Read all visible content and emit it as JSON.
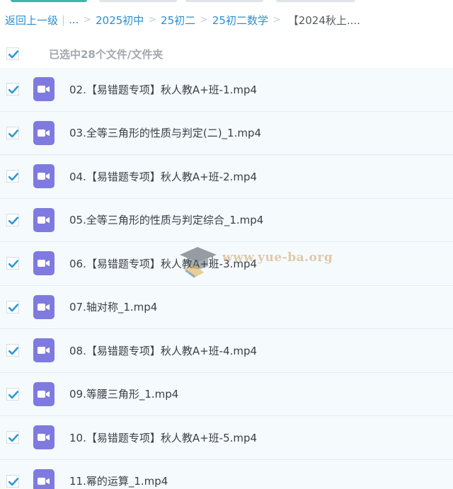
{
  "breadcrumb": {
    "back_label": "返回上一级",
    "separator_bar": "|",
    "ellipsis": "...",
    "chevron": ">",
    "items": [
      "2025初中",
      "25初二",
      "25初二数学"
    ],
    "current": "【2024秋上...."
  },
  "selection": {
    "summary": "已选中28个文件/文件夹",
    "select_all_checked": true
  },
  "files": [
    {
      "name": "02.【易错题专项】秋人教A+班-1.mp4",
      "checked": true,
      "icon": "video-file-icon"
    },
    {
      "name": "03.全等三角形的性质与判定(二)_1.mp4",
      "checked": true,
      "icon": "video-file-icon"
    },
    {
      "name": "04.【易错题专项】秋人教A+班-2.mp4",
      "checked": true,
      "icon": "video-file-icon"
    },
    {
      "name": "05.全等三角形的性质与判定综合_1.mp4",
      "checked": true,
      "icon": "video-file-icon"
    },
    {
      "name": "06.【易错题专项】秋人教A+班-3.mp4",
      "checked": true,
      "icon": "video-file-icon"
    },
    {
      "name": "07.轴对称_1.mp4",
      "checked": true,
      "icon": "video-file-icon"
    },
    {
      "name": "08.【易错题专项】秋人教A+班-4.mp4",
      "checked": true,
      "icon": "video-file-icon"
    },
    {
      "name": "09.等腰三角形_1.mp4",
      "checked": true,
      "icon": "video-file-icon"
    },
    {
      "name": "10.【易错题专项】秋人教A+班-5.mp4",
      "checked": true,
      "icon": "video-file-icon"
    },
    {
      "name": "11.幂的运算_1.mp4",
      "checked": true,
      "icon": "video-file-icon"
    }
  ],
  "watermark": {
    "text": "www.yue-ba.org"
  },
  "colors": {
    "accent": "#2b8fcf",
    "checkbox": "#2a9ad6",
    "video_icon": "#7f7ae0",
    "row_bg": "#f5fafd"
  }
}
